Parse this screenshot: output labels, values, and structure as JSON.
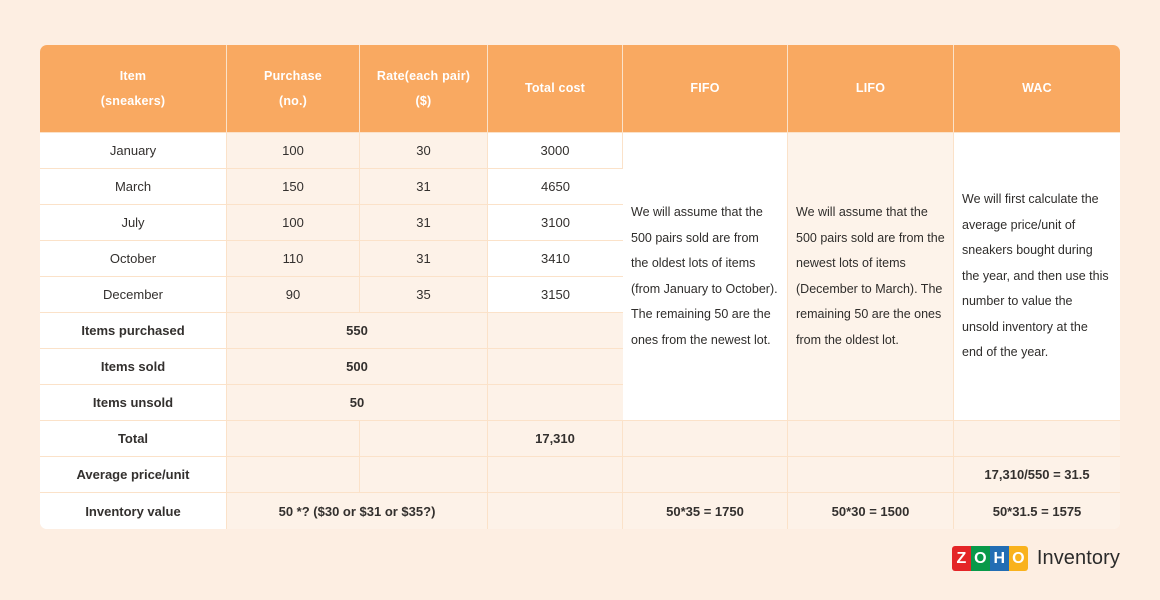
{
  "table": {
    "headers": [
      {
        "line1": "Item",
        "line2": "(sneakers)"
      },
      {
        "line1": "Purchase",
        "line2": "(no.)"
      },
      {
        "line1": "Rate(each pair)",
        "line2": "($)"
      },
      {
        "line1": "Total cost",
        "line2": ""
      },
      {
        "line1": "FIFO",
        "line2": ""
      },
      {
        "line1": "LIFO",
        "line2": ""
      },
      {
        "line1": "WAC",
        "line2": ""
      }
    ],
    "month_rows": [
      {
        "item": "January",
        "purchase": "100",
        "rate": "30",
        "total_cost": "3000"
      },
      {
        "item": "March",
        "purchase": "150",
        "rate": "31",
        "total_cost": "4650"
      },
      {
        "item": "July",
        "purchase": "100",
        "rate": "31",
        "total_cost": "3100"
      },
      {
        "item": "October",
        "purchase": "110",
        "rate": "31",
        "total_cost": "3410"
      },
      {
        "item": "December",
        "purchase": "90",
        "rate": "35",
        "total_cost": "3150"
      }
    ],
    "summary_rows": [
      {
        "label": "Items purchased",
        "merged_value": "550"
      },
      {
        "label": "Items sold",
        "merged_value": "500"
      },
      {
        "label": "Items unsold",
        "merged_value": "50"
      }
    ],
    "total_row": {
      "label": "Total",
      "total_cost": "17,310"
    },
    "average_row": {
      "label": "Average price/unit",
      "wac": "17,310/550 = 31.5"
    },
    "inventory_row": {
      "label": "Inventory value",
      "merged_value": "50 *? ($30 or $31 or $35?)",
      "fifo": "50*35 = 1750",
      "lifo": "50*30 = 1500",
      "wac": "50*31.5 = 1575"
    },
    "notes": {
      "fifo": "We will assume that the 500 pairs sold are from the oldest lots of items (from January to October). The remaining 50 are the ones from the newest lot.",
      "lifo": "We will assume that the 500 pairs sold are from the newest lots of items (December to March). The remaining 50 are the ones from the oldest lot.",
      "wac": "We will first calculate the average price/unit of sneakers bought during the year, and then use this number to value the unsold inventory at the end of the year."
    }
  },
  "logo": {
    "letters": [
      "Z",
      "O",
      "H",
      "O"
    ],
    "product": "Inventory"
  },
  "colors": {
    "header_orange": "#f9a961",
    "page_background": "#fdeee2",
    "tint": "#fdf2e8",
    "border": "#fbe2c9"
  }
}
